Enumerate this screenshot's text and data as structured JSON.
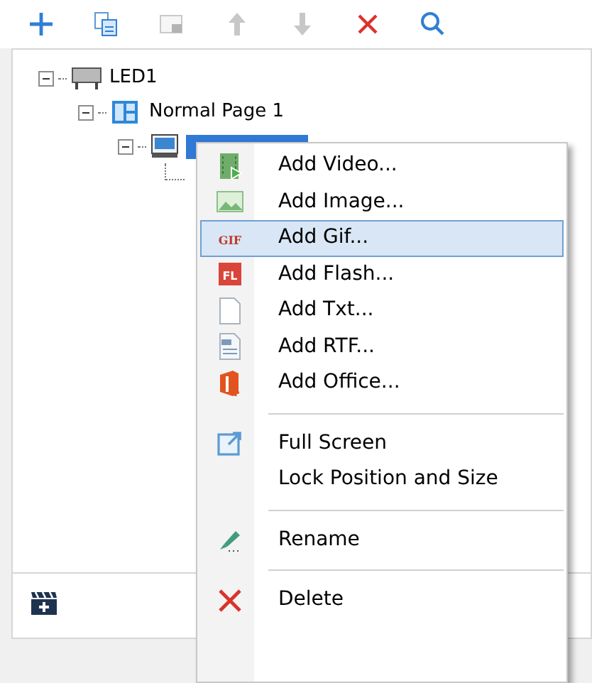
{
  "toolbar": [
    {
      "kind": "add",
      "disabled": false
    },
    {
      "kind": "copy",
      "disabled": false
    },
    {
      "kind": "paste",
      "disabled": true
    },
    {
      "kind": "up",
      "disabled": true
    },
    {
      "kind": "down",
      "disabled": true
    },
    {
      "kind": "delete",
      "disabled": false
    },
    {
      "kind": "search",
      "disabled": false
    }
  ],
  "tree": [
    {
      "label": "LED1",
      "kind": "screen",
      "expanded": true,
      "selected": false,
      "children": [
        {
          "label": "Normal Page 1",
          "kind": "page",
          "expanded": true,
          "selected": false,
          "children": [
            {
              "kind": "window",
              "expanded": true,
              "selected": true,
              "children": [
                {
                  "kind": "leaf"
                }
              ]
            }
          ]
        }
      ]
    }
  ],
  "context_menu": [
    {
      "kind": "item",
      "label": "Add Video...",
      "selected": false
    },
    {
      "kind": "item",
      "label": "Add Image...",
      "selected": false
    },
    {
      "kind": "item",
      "icon_text": "GIF",
      "label": "Add Gif...",
      "selected": true
    },
    {
      "kind": "item",
      "icon_text": "FL",
      "label": "Add Flash...",
      "selected": false
    },
    {
      "kind": "item",
      "label": "Add Txt...",
      "selected": false
    },
    {
      "kind": "item",
      "label": "Add RTF...",
      "selected": false
    },
    {
      "kind": "item",
      "label": "Add Office...",
      "selected": false
    },
    {
      "kind": "separator"
    },
    {
      "kind": "item",
      "label": "Full Screen",
      "selected": false
    },
    {
      "kind": "item",
      "label": "Lock Position and Size",
      "selected": false
    },
    {
      "kind": "separator"
    },
    {
      "kind": "item",
      "label": "Rename",
      "selected": false
    },
    {
      "kind": "separator"
    },
    {
      "kind": "item",
      "label": "Delete",
      "selected": false
    }
  ]
}
